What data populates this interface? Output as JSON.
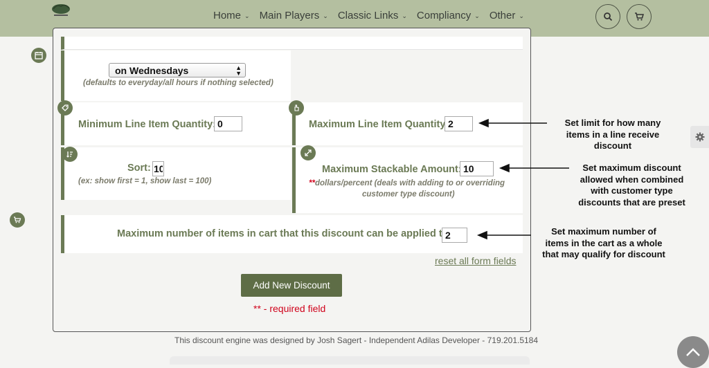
{
  "nav": {
    "items": [
      {
        "label": "Home"
      },
      {
        "label": "Main Players"
      },
      {
        "label": "Classic Links"
      },
      {
        "label": "Compliancy"
      },
      {
        "label": "Other"
      }
    ],
    "search_icon": "search-icon",
    "cart_icon": "cart-icon"
  },
  "form": {
    "day_select": {
      "value": "on Wednesdays",
      "hint": "(defaults to everyday/all hours if nothing selected)"
    },
    "min_qty": {
      "label": "Minimum Line Item Quantity:",
      "value": "0"
    },
    "max_qty": {
      "label": "Maximum Line Item Quantity",
      "value": "2"
    },
    "sort": {
      "label": "Sort:",
      "value": "10",
      "hint": "(ex: show first = 1, show last = 100)"
    },
    "max_stack": {
      "label": "Maximum Stackable Amount:",
      "value": "10",
      "req_marker": "**",
      "hint_line1": "dollars/percent (deals with adding to or overriding",
      "hint_line2": "customer type discount)"
    },
    "max_cart_items": {
      "label": "Maximum number of items in cart that this discount can be applied to:",
      "value": "2"
    },
    "reset_label": "reset all form fields",
    "add_button_label": "Add New Discount",
    "required_note": "** - required field"
  },
  "annotations": {
    "line_limit": [
      "Set limit for how many",
      "items in a line receive",
      "discount"
    ],
    "max_discount": [
      "Set maximum discount",
      "allowed when combined",
      "with customer type",
      "discounts that are preset"
    ],
    "max_cart": [
      "Set maximum number of",
      "items in the cart as a whole",
      "that may qualify for discount"
    ]
  },
  "footer": "This discount engine was designed by Josh Sagert - Independent Adilas Developer - 719.201.5184",
  "colors": {
    "accent": "#6b7a55",
    "topbar": "#b4bfa0",
    "required": "#d0021b",
    "button": "#5e6d46"
  }
}
